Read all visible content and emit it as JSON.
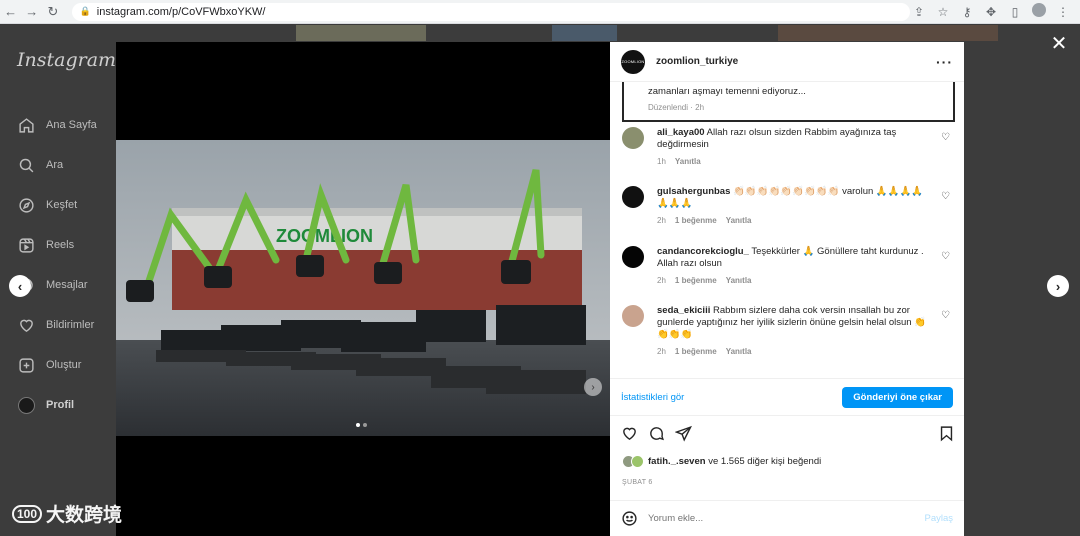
{
  "browser": {
    "url": "instagram.com/p/CoVFWbxoYKW/"
  },
  "instagram": {
    "logo": "Instagram",
    "nav": [
      {
        "label": "Ana Sayfa",
        "icon": "home-icon"
      },
      {
        "label": "Ara",
        "icon": "search-icon"
      },
      {
        "label": "Keşfet",
        "icon": "compass-icon"
      },
      {
        "label": "Reels",
        "icon": "reels-icon"
      },
      {
        "label": "Mesajlar",
        "icon": "messenger-icon"
      },
      {
        "label": "Bildirimler",
        "icon": "heart-icon"
      },
      {
        "label": "Oluştur",
        "icon": "plus-square-icon"
      },
      {
        "label": "Profil",
        "icon": "profile-avatar"
      }
    ]
  },
  "post": {
    "author": "zoomlion_turkiye",
    "author_avatar_text": "ZOOMLION",
    "sign_text": "ZOOMLION",
    "caption_tail": "zamanları aşmayı temenni ediyoruz...",
    "caption_meta": "Düzenlendi · 2h",
    "comments": [
      {
        "user": "ali_kaya00",
        "text": "Allah razı olsun sizden Rabbim ayağınıza taş değdirmesin",
        "time": "1h",
        "likes": "",
        "reply": "Yanıtla",
        "avatar_color": "#8a8f6e"
      },
      {
        "user": "gulsahergunbas",
        "text": "👏🏻👏🏻👏🏻👏🏻👏🏻👏🏻👏🏻👏🏻👏🏻 varolun 🙏🙏🙏🙏🙏🙏🙏",
        "time": "2h",
        "likes": "1 beğenme",
        "reply": "Yanıtla",
        "avatar_color": "#111111"
      },
      {
        "user": "candancorekcioglu_",
        "text": "Teşekkürler 🙏 Gönüllere taht kurdunuz . Allah razı olsun",
        "time": "2h",
        "likes": "1 beğenme",
        "reply": "Yanıtla",
        "avatar_color": "#050505"
      },
      {
        "user": "seda_ekiciii",
        "text": "Rabbım sizlere daha cok versin ınsallah bu zor gunlerde yaptığınız her iyilik sizlerin önüne gelsin helal olsun 👏👏👏👏",
        "time": "2h",
        "likes": "1 beğenme",
        "reply": "Yanıtla",
        "avatar_color": "#c9a38e"
      }
    ],
    "stats_link": "İstatistikleri gör",
    "promote_button": "Gönderiyi öne çıkar",
    "likes_text_user": "fatih._.seven",
    "likes_text_rest": "ve 1.565 diğer kişi beğendi",
    "date": "ŞUBAT 6",
    "comment_placeholder": "Yorum ekle...",
    "share_label": "Paylaş"
  },
  "watermark": {
    "logo": "100",
    "text": "大数跨境"
  },
  "colors": {
    "accent_blue": "#0095f6",
    "overlay": "#3c3c3c"
  }
}
